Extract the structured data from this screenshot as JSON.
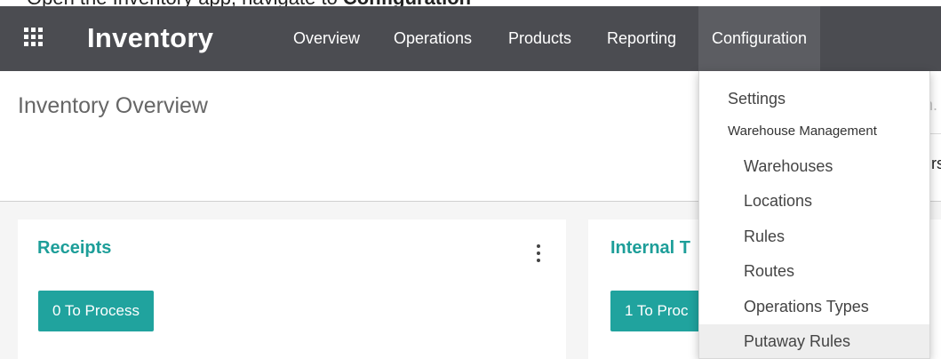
{
  "top_strip_text": {
    "prefix": "Inventory",
    "bold": "Configuration"
  },
  "navbar": {
    "brand": "Inventory",
    "menu": [
      "Overview",
      "Operations",
      "Products",
      "Reporting",
      "Configuration"
    ]
  },
  "control_panel": {
    "title": "Inventory Overview",
    "search_clip": "n.",
    "right_clip": "rs"
  },
  "cards": [
    {
      "title": "Receipts",
      "button": "0 To Process"
    },
    {
      "title": "Internal T",
      "button": "1 To Proc"
    }
  ],
  "configuration_menu": {
    "settings": "Settings",
    "section_header": "Warehouse Management",
    "items": [
      "Warehouses",
      "Locations",
      "Rules",
      "Routes",
      "Operations Types",
      "Putaway Rules"
    ],
    "highlighted_item": "Putaway Rules"
  },
  "colors": {
    "navbar": "#4b4c51",
    "accent": "#1d9e99",
    "button": "#20a39e"
  }
}
